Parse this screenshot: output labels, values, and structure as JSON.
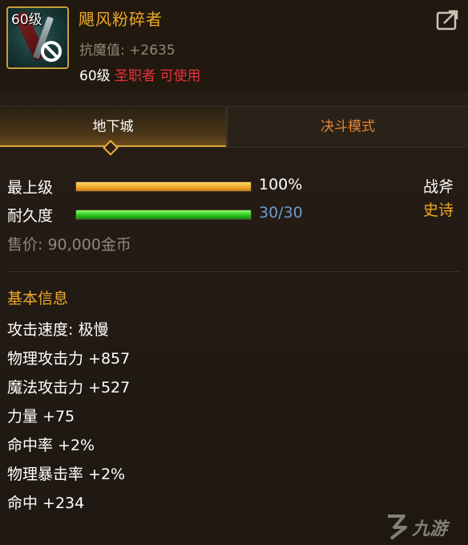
{
  "item": {
    "level_badge": "60级",
    "name": "飓风粉碎者",
    "resist_label": "抗魔值:",
    "resist_value": "+2635",
    "req_level": "60级",
    "req_class": "圣职者",
    "req_usable": "可使用"
  },
  "tabs": [
    {
      "label": "地下城",
      "active": true
    },
    {
      "label": "决斗模式",
      "active": false
    }
  ],
  "stats": {
    "grade_label": "最上级",
    "grade_value": "100%",
    "grade_fraction": 1.0,
    "durability_label": "耐久度",
    "durability_value": "30/30",
    "durability_fraction": 1.0,
    "weapon_type": "战斧",
    "rarity": "史诗",
    "rarity_color": "#f0a928"
  },
  "price": {
    "label": "售价:",
    "value": "90,000金币"
  },
  "basic_info": {
    "title": "基本信息",
    "rows": [
      "攻击速度: 极慢",
      "物理攻击力 +857",
      "魔法攻击力 +527",
      "力量 +75",
      "命中率 +2%",
      "物理暴击率 +2%",
      "命中 +234"
    ]
  },
  "watermark": {
    "text": "九游"
  },
  "colors": {
    "name_gold": "#f0a928",
    "warning_red": "#e8323a",
    "grade_bar": "#f0a628",
    "durability_bar": "#27c11f"
  },
  "icons": {
    "item": "weapon-icon",
    "forbid": "forbidden-icon",
    "share": "share-icon",
    "watermark": "jiuyou-logo"
  }
}
